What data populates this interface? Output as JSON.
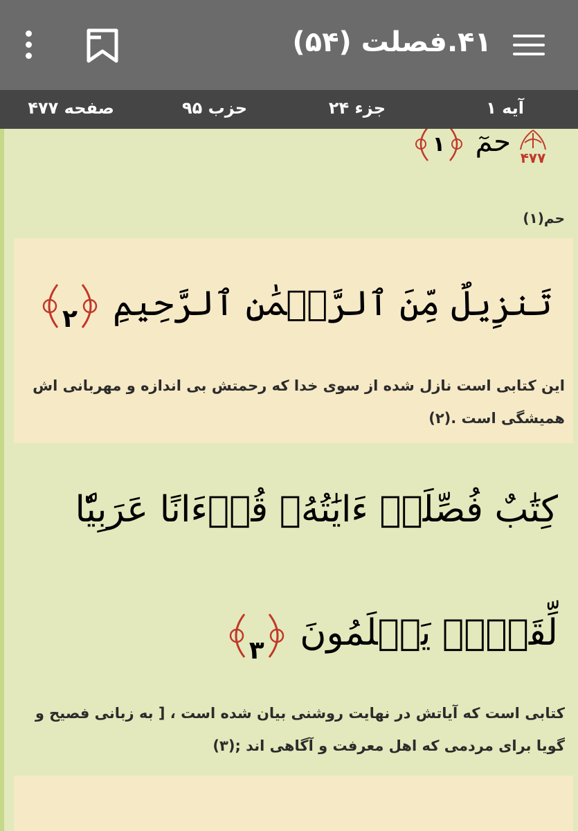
{
  "appbar": {
    "title": "۴۱.فصلت (۵۴)",
    "menu_icon": "menu-icon",
    "bookmark_icon": "bookmark-icon",
    "more_icon": "more-vert-icon"
  },
  "infobar": {
    "aye": "آیه ۱",
    "juz": "جزء ۲۴",
    "hizb": "حزب ۹۵",
    "page": "صفحه ۴۷۷"
  },
  "colors": {
    "appbar": "#6b6b6b",
    "infobar": "#454545",
    "green_block": "#e3e9bc",
    "cream_block": "#f6e9c6",
    "marker_red": "#c0392b"
  },
  "page_marker": "۴۷۷",
  "verses": [
    {
      "arabic": "حمٓ",
      "number": "١",
      "translation": "حم(۱)"
    },
    {
      "arabic": "تَنزِيلٌ مِّنَ ٱلرَّحۡمَٰنِ ٱلرَّحِيمِ",
      "number": "٢",
      "translation": "این کتابی است نازل شده از سوی خدا که رحمتش بی اندازه و مهربانی اش همیشگی است .(۲)"
    },
    {
      "arabic_line1": "كِتَٰبٌ فُصِّلَتۡ ءَايَٰتُهُۥ قُرۡءَانًا عَرَبِيّٗا",
      "arabic_line2": "لِّقَوۡمٖ يَعۡلَمُونَ",
      "number": "٣",
      "translation": "کتابی است که آیاتش در نهایت روشنی بیان شده است ، [ به زبانی فصیح و گویا برای مردمی که اهل معرفت و آگاهی اند ;(۳)"
    }
  ]
}
